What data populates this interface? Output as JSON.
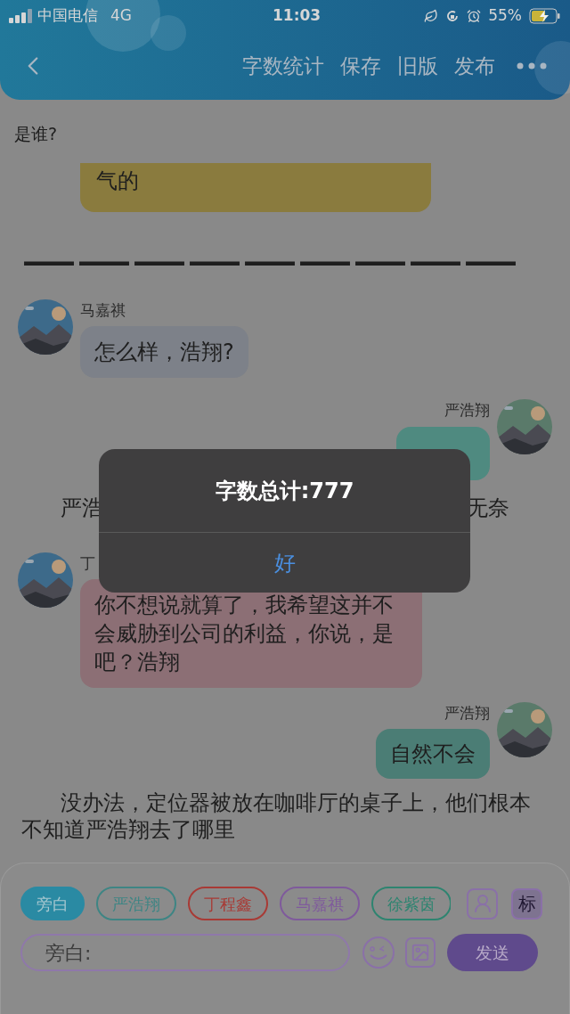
{
  "status_bar": {
    "carrier": "中国电信",
    "network": "4G",
    "time": "11:03",
    "battery": "55%",
    "charging": true
  },
  "header": {
    "actions": [
      "字数统计",
      "保存",
      "旧版",
      "发布"
    ]
  },
  "messages": [
    {
      "kind": "narration",
      "text": "是谁?",
      "indent": false
    },
    {
      "kind": "partial",
      "text": "气的",
      "color": "#8a7b3e"
    },
    {
      "kind": "rule",
      "text": "—————————"
    },
    {
      "kind": "left",
      "name": "马嘉祺",
      "text": "怎么样，浩翔?",
      "color": "#7d8189"
    },
    {
      "kind": "right",
      "name": "严浩翔",
      "color": "#4f8a80"
    },
    {
      "kind": "split",
      "left": "严浩",
      "right": "无奈"
    },
    {
      "kind": "left",
      "name": "丁",
      "text": "你不想说就算了，我希望这并不会威胁到公司的利益，你说，是吧？浩翔",
      "color": "#8c6f75"
    },
    {
      "kind": "right",
      "name": "严浩翔",
      "text": "自然不会",
      "color": "#4b7d75"
    },
    {
      "kind": "narration",
      "text": "没办法，定位器被放在咖啡厅的桌子上，他们根本不知道严浩翔去了哪里",
      "indent": true
    }
  ],
  "footer": {
    "roles": [
      {
        "label": "旁白",
        "color": "#2a8aa3",
        "selected": true
      },
      {
        "label": "严浩翔",
        "color": "#3e8584",
        "selected": false
      },
      {
        "label": "丁程鑫",
        "color": "#a83a35",
        "selected": false
      },
      {
        "label": "马嘉祺",
        "color": "#7f5a9c",
        "selected": false
      },
      {
        "label": "徐紫茵",
        "color": "#2e8470",
        "selected": false
      }
    ],
    "mark_button": "标",
    "input": {
      "placeholder": "旁白:"
    },
    "send": "发送"
  },
  "alert": {
    "title": "字数总计:777",
    "button": "好"
  }
}
